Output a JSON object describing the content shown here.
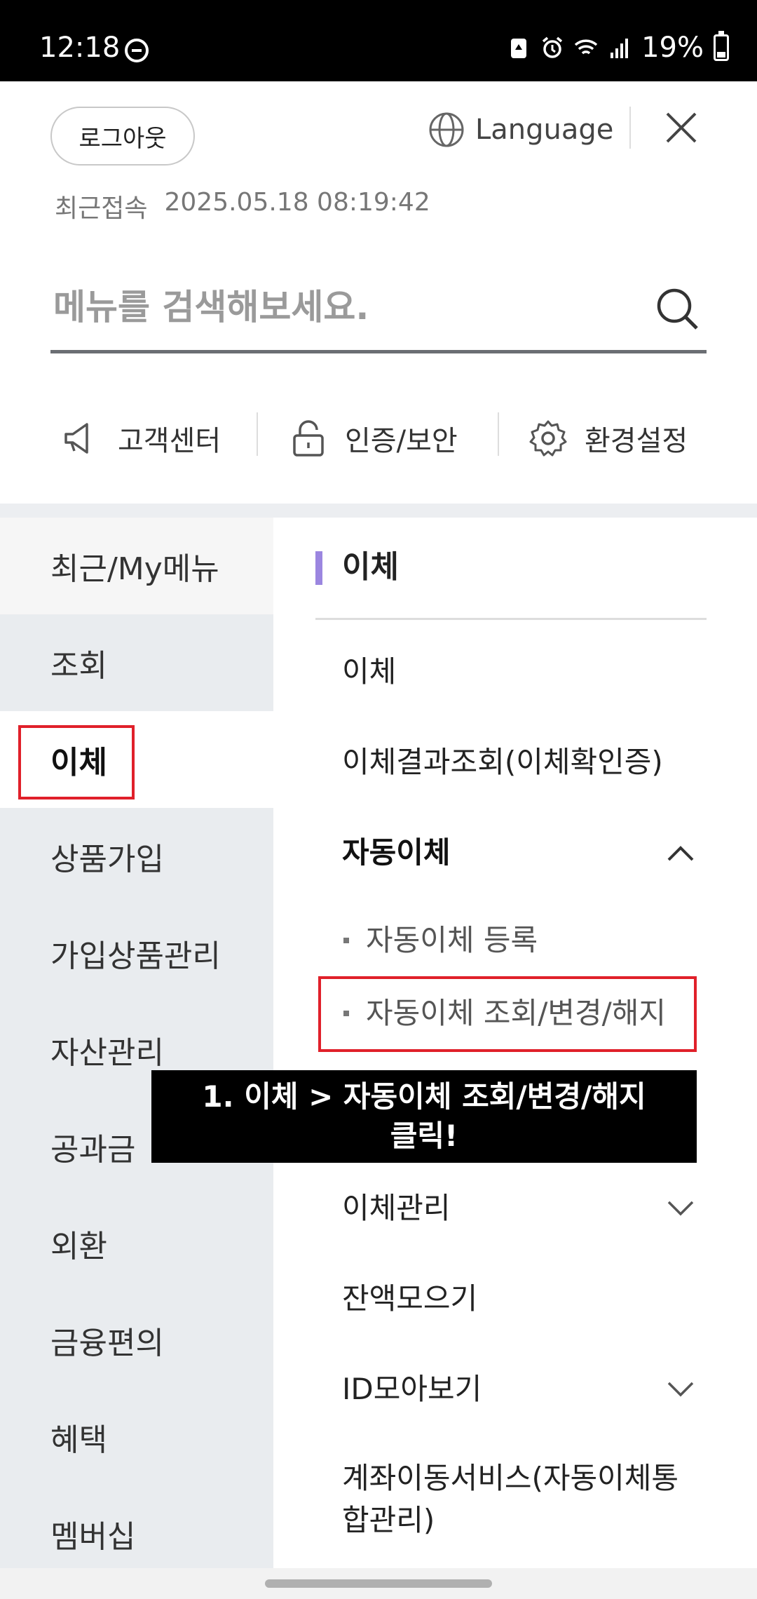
{
  "status_bar": {
    "time": "12:18",
    "battery_pct": "19%",
    "icons": [
      "dnd-icon",
      "recycle-icon",
      "alarm-icon",
      "wifi-icon",
      "signal-icon",
      "battery-icon"
    ]
  },
  "header": {
    "logout_label": "로그아웃",
    "language_label": "Language",
    "last_login_label": "최근접속",
    "last_login_value": "2025.05.18 08:19:42"
  },
  "search": {
    "placeholder": "메뉴를 검색해보세요."
  },
  "quick_links": [
    {
      "label": "고객센터",
      "icon": "megaphone-icon"
    },
    {
      "label": "인증/보안",
      "icon": "lock-icon"
    },
    {
      "label": "환경설정",
      "icon": "gear-icon"
    }
  ],
  "left_nav": {
    "items": [
      {
        "label": "최근/My메뉴"
      },
      {
        "label": "조회"
      },
      {
        "label": "이체"
      },
      {
        "label": "상품가입"
      },
      {
        "label": "가입상품관리"
      },
      {
        "label": "자산관리"
      },
      {
        "label": "공과금"
      },
      {
        "label": "외환"
      },
      {
        "label": "금융편의"
      },
      {
        "label": "혜택"
      },
      {
        "label": "멤버십"
      }
    ],
    "active_label": "이체"
  },
  "right_panel": {
    "title": "이체",
    "items": [
      {
        "label": "이체"
      },
      {
        "label": "이체결과조회(이체확인증)"
      },
      {
        "label": "자동이체"
      },
      {
        "label": "자동이체 등록"
      },
      {
        "label": "자동이체 조회/변경/해지"
      },
      {
        "label": "이체관리"
      },
      {
        "label": "잔액모으기"
      },
      {
        "label": "ID모아보기"
      },
      {
        "label": "계좌이동서비스(자동이체통"
      },
      {
        "label": "합관리)"
      }
    ]
  },
  "annotation": {
    "line1": "1. 이체 > 자동이체 조회/변경/해지",
    "line2": "클릭!"
  },
  "colors": {
    "accent_purple": "#9b86e0",
    "highlight_red": "#e0202a",
    "nav_bg": "#e9ecef"
  }
}
